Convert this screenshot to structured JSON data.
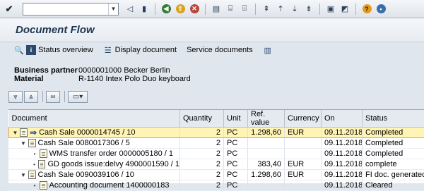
{
  "toolbar": {
    "command_value": "",
    "icons": [
      "enter-icon",
      "back-icon",
      "exit-icon",
      "cancel-icon",
      "print-icon",
      "find-icon",
      "find-next-icon",
      "first-page-icon",
      "prev-page-icon",
      "next-page-icon",
      "last-page-icon",
      "new-session-icon",
      "shortcut-icon",
      "help-icon",
      "customize-icon"
    ]
  },
  "title": "Document Flow",
  "app_toolbar": {
    "status_overview": "Status overview",
    "display_document": "Display document",
    "service_documents": "Service documents"
  },
  "header": {
    "business_partner_label": "Business partner",
    "business_partner_value": "0000001000 Becker Berlin",
    "material_label": "Material",
    "material_value": "R-1140 Intex Polo Duo keyboard"
  },
  "table": {
    "columns": {
      "document": "Document",
      "quantity": "Quantity",
      "unit": "Unit",
      "ref_value": "Ref. value",
      "currency": "Currency",
      "on": "On",
      "status": "Status"
    },
    "rows": [
      {
        "document": "Cash Sale 0000014745 / 10",
        "quantity": "2",
        "unit": "PC",
        "ref_value": "1.298,60",
        "currency": "EUR",
        "on": "09.11.2018",
        "status": "Completed"
      },
      {
        "document": "Cash Sale 0080017306 / 5",
        "quantity": "2",
        "unit": "PC",
        "ref_value": "",
        "currency": "",
        "on": "09.11.2018",
        "status": "Completed"
      },
      {
        "document": "WMS transfer order 0000005180 / 1",
        "quantity": "2",
        "unit": "PC",
        "ref_value": "",
        "currency": "",
        "on": "09.11.2018",
        "status": "Completed"
      },
      {
        "document": "GD goods issue:delvy 4900001590 / 1",
        "quantity": "2",
        "unit": "PC",
        "ref_value": "383,40",
        "currency": "EUR",
        "on": "09.11.2018",
        "status": "complete"
      },
      {
        "document": "Cash Sale 0090039106 / 10",
        "quantity": "2",
        "unit": "PC",
        "ref_value": "1.298,60",
        "currency": "EUR",
        "on": "09.11.2018",
        "status": "FI doc. generated"
      },
      {
        "document": "Accounting document 1400000183",
        "quantity": "2",
        "unit": "PC",
        "ref_value": "",
        "currency": "",
        "on": "09.11.2018",
        "status": "Cleared"
      }
    ]
  },
  "colors": {
    "selected_row": "#fff4b3",
    "selected_border": "#e3a53a",
    "title": "#1e3551"
  }
}
